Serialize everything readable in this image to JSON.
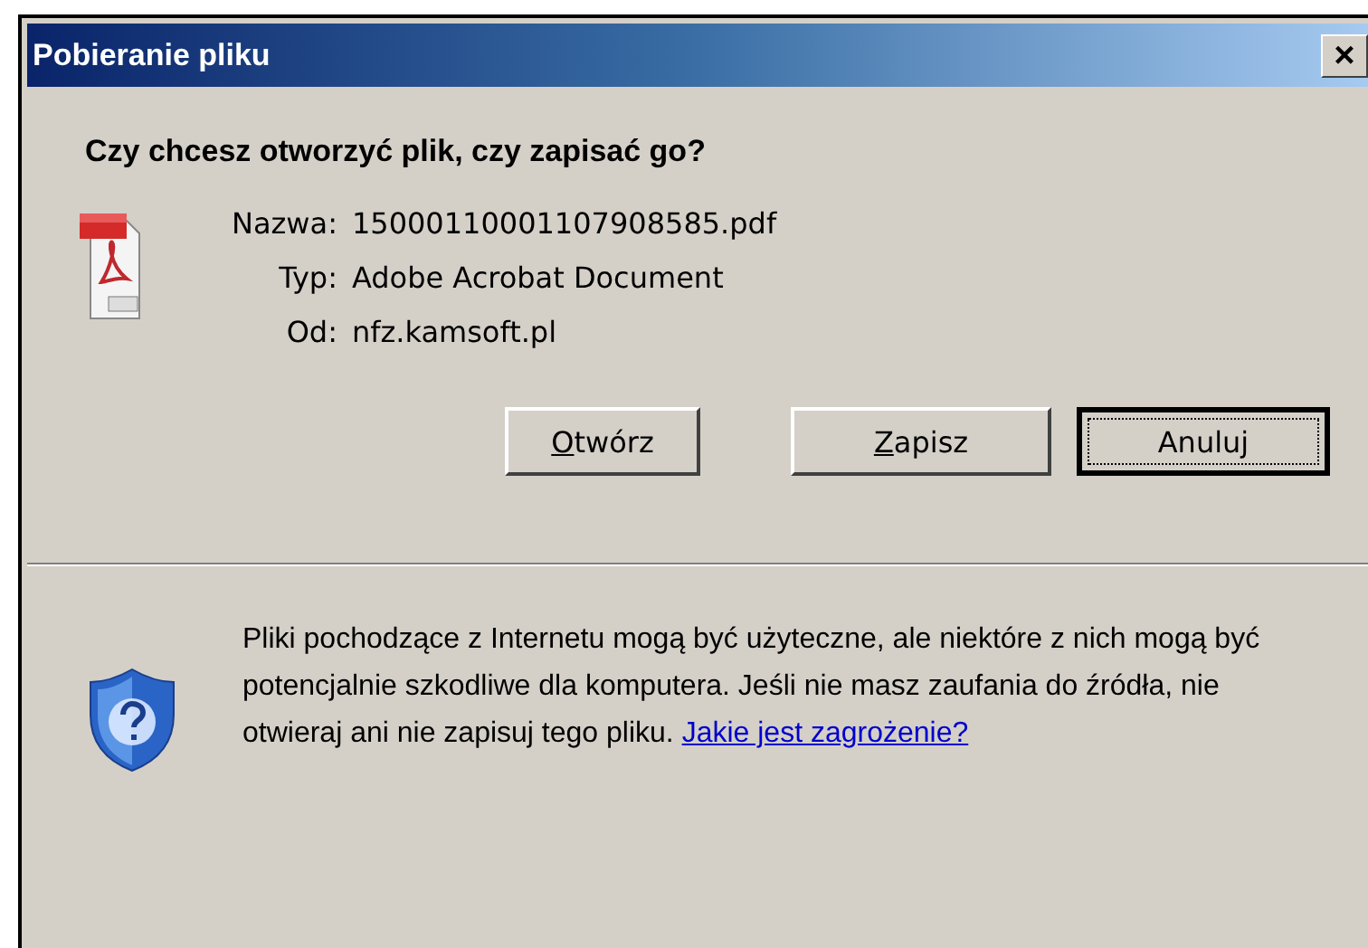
{
  "window": {
    "title": "Pobieranie pliku",
    "close": "×"
  },
  "question": "Czy chcesz otworzyć plik, czy zapisać go?",
  "file_info": [
    {
      "label": "Nazwa:",
      "value": "15000110001107908585.pdf"
    },
    {
      "label": "Typ:",
      "value": "Adobe Acrobat Document"
    },
    {
      "label": "Od:",
      "value": "nfz.kamsoft.pl"
    }
  ],
  "buttons": [
    {
      "label": "Otwórz",
      "mnemonic": true,
      "default": false
    },
    {
      "label": "Zapisz",
      "mnemonic": true,
      "default": false
    },
    {
      "label": "Anuluj",
      "mnemonic": false,
      "default": true
    }
  ],
  "warning": {
    "text": "Pliki pochodzące z Internetu mogą być użyteczne, ale niektóre z nich mogą być potencjalnie szkodliwe dla komputera. Jeśli nie masz zaufania do źródła, nie otwieraj ani nie zapisuj tego pliku.",
    "link": "Jakie jest zagrożenie?"
  }
}
